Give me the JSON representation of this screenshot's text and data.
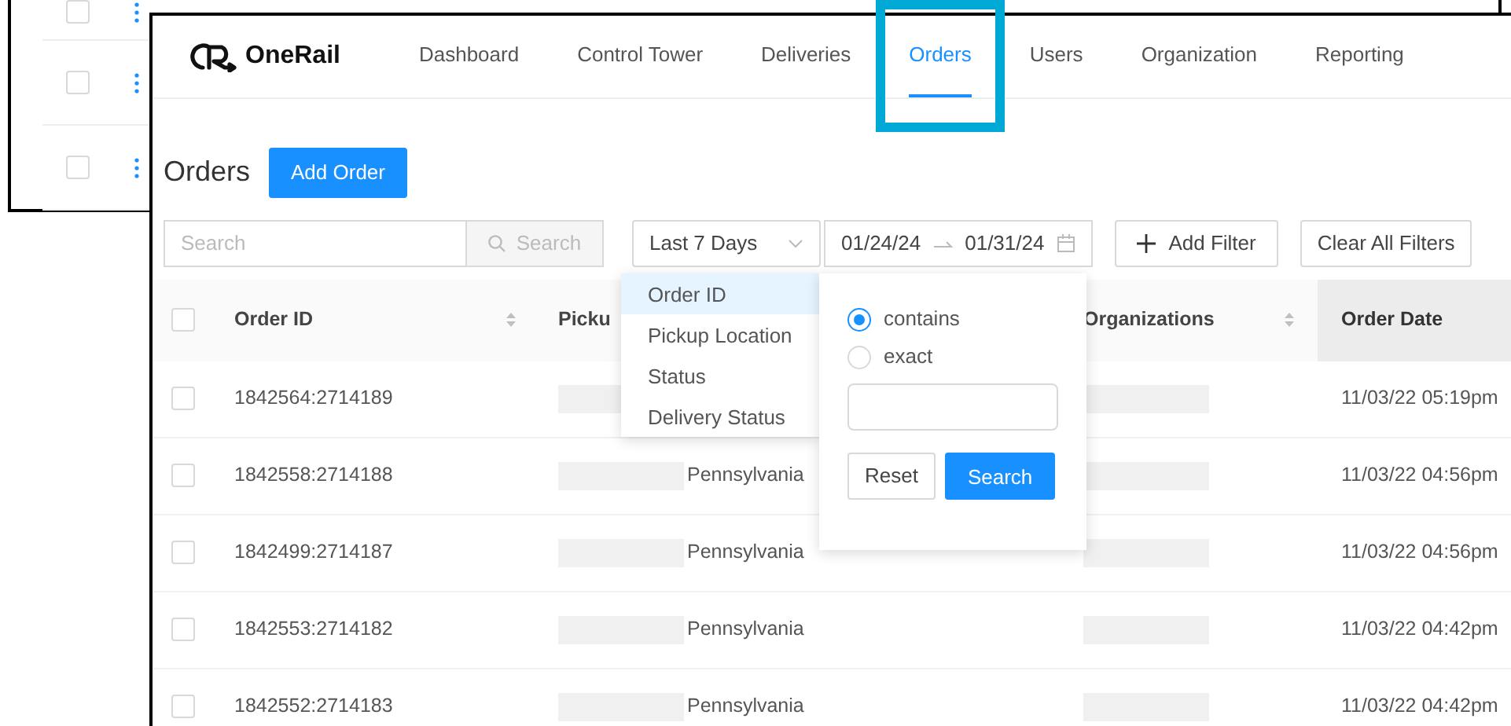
{
  "background_window": {
    "rows": [
      {
        "checked": false
      },
      {
        "checked": false
      },
      {
        "checked": false
      }
    ]
  },
  "window": {
    "brand": "OneRail",
    "nav_tabs": [
      {
        "label": "Dashboard",
        "selected": false,
        "highlighted": false
      },
      {
        "label": "Control Tower",
        "selected": false,
        "highlighted": false
      },
      {
        "label": "Deliveries",
        "selected": false,
        "highlighted": false
      },
      {
        "label": "Orders",
        "selected": true,
        "highlighted": true
      },
      {
        "label": "Users",
        "selected": false,
        "highlighted": false
      },
      {
        "label": "Organization",
        "selected": false,
        "highlighted": false
      },
      {
        "label": "Reporting",
        "selected": false,
        "highlighted": false
      }
    ],
    "page_title": "Orders",
    "add_button": "Add Order",
    "filters": {
      "search": {
        "placeholder": "Search"
      },
      "search_button": "Search",
      "range_select": "Last 7 Days",
      "date_from": "01/24/24",
      "date_to": "01/31/24",
      "add_filter": "Add Filter",
      "clear_filters": "Clear All Filters"
    },
    "table": {
      "select_all_checked": false,
      "columns": [
        {
          "label": "Order ID",
          "sortable": true,
          "sorted": false
        },
        {
          "label": "Picku",
          "sortable": false,
          "sorted": false
        },
        {
          "label": "Organizations",
          "sortable": true,
          "sorted": false
        },
        {
          "label": "Order Date",
          "sortable": false,
          "sorted": true
        }
      ],
      "rows": [
        {
          "checked": false,
          "order_id": "1842564:2714189",
          "date": "11/03/22 05:19pm"
        },
        {
          "checked": false,
          "order_id": "1842558:2714188",
          "pickup": "Pennsylvania",
          "date": "11/03/22 04:56pm"
        },
        {
          "checked": false,
          "order_id": "1842499:2714187",
          "pickup": "Pennsylvania",
          "date": "11/03/22 04:56pm"
        },
        {
          "checked": false,
          "order_id": "1842553:2714182",
          "pickup": "Pennsylvania",
          "date": "11/03/22 04:42pm"
        },
        {
          "checked": false,
          "order_id": "1842552:2714183",
          "pickup": "Pennsylvania",
          "date": "11/03/22 04:42pm"
        }
      ]
    },
    "field_menu": [
      {
        "label": "Order ID",
        "selected": true
      },
      {
        "label": "Pickup Location",
        "selected": false
      },
      {
        "label": "Status",
        "selected": false
      },
      {
        "label": "Delivery Status",
        "selected": false
      }
    ],
    "match_popover": {
      "options": [
        {
          "label": "contains",
          "selected": true
        },
        {
          "label": "exact",
          "selected": false
        }
      ],
      "reset": "Reset",
      "search": "Search"
    }
  }
}
